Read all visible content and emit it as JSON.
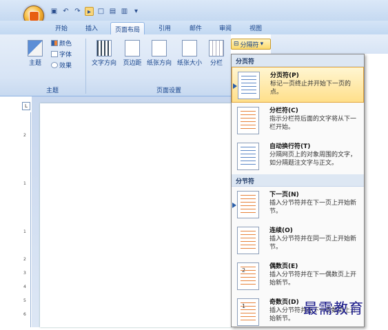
{
  "qat": {
    "items": [
      "save-icon",
      "undo-icon",
      "redo-icon",
      "highlight-icon",
      "new-icon",
      "open-icon",
      "print-icon",
      "dropdown-icon"
    ]
  },
  "tabs": [
    "开始",
    "插入",
    "页面布局",
    "引用",
    "邮件",
    "审阅",
    "视图"
  ],
  "ribbon": {
    "themes": {
      "button": "主题",
      "colors": "颜色",
      "fonts": "字体",
      "effects": "效果",
      "group": "主题"
    },
    "page_setup": {
      "text_direction": "文字方向",
      "margins": "页边距",
      "orientation": "纸张方向",
      "size": "纸张大小",
      "columns": "分栏",
      "group": "页面设置"
    },
    "breaks_button": "分隔符"
  },
  "ruler": {
    "corner": "L",
    "numbers": [
      "2",
      "1",
      "1",
      "2",
      "3",
      "4",
      "5",
      "6"
    ]
  },
  "menu": {
    "section_page": "分页符",
    "section_section": "分节符",
    "items": [
      {
        "title": "分页符(P)",
        "desc": "标记一页终止并开始下一页的点。",
        "selected": true
      },
      {
        "title": "分栏符(C)",
        "desc": "指示分栏符后面的文字将从下一栏开始。"
      },
      {
        "title": "自动换行符(T)",
        "desc": "分隔网页上的对象周围的文字，如分隔题注文字与正文。"
      },
      {
        "title": "下一页(N)",
        "desc": "插入分节符并在下一页上开始新节。"
      },
      {
        "title": "连续(O)",
        "desc": "插入分节符并在同一页上开始新节。"
      },
      {
        "title": "偶数页(E)",
        "desc": "插入分节符并在下一偶数页上开始新节。",
        "number": "2"
      },
      {
        "title": "奇数页(D)",
        "desc": "插入分节符并在下一奇数页上开始新节。",
        "number": "1"
      }
    ]
  },
  "watermark": "最需教育",
  "colors": {
    "ribbon": "#d7e4f5",
    "highlight": "#ffdf8a",
    "accent": "#15428b"
  }
}
